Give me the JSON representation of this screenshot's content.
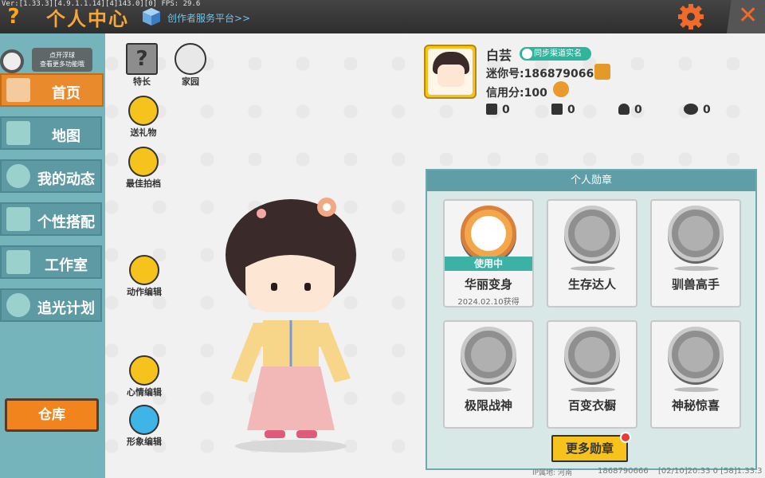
{
  "topbar": {
    "debug": "Ver:[1.33.3][4.9.1.1.14][4]143.0][0] FPS: 29.6",
    "help": "?",
    "title": "个人中心",
    "creator_link": "创作者服务平台>>",
    "close": "✕"
  },
  "float_tip": {
    "line1": "点开浮球",
    "line2": "查看更多功能哦"
  },
  "sidebar": {
    "items": [
      {
        "label": "首页",
        "active": true
      },
      {
        "label": "地图"
      },
      {
        "label": "我的动态"
      },
      {
        "label": "个性搭配"
      },
      {
        "label": "工作室"
      },
      {
        "label": "追光计划"
      }
    ],
    "warehouse": "仓库"
  },
  "side_buttons": {
    "specialty": "特长",
    "home": "家园",
    "gift": "送礼物",
    "best_photo": "最佳拍档",
    "action_edit": "动作编辑",
    "mood_edit": "心情编辑",
    "look_edit": "形象编辑"
  },
  "profile": {
    "name": "白芸",
    "realname_badge": "同步渠道实名",
    "mini_id": "迷你号:1868790666",
    "credit": "信用分:100",
    "stats": [
      "0",
      "0",
      "0",
      "0"
    ]
  },
  "medals": {
    "header": "个人勋章",
    "items": [
      {
        "name": "华丽变身",
        "date": "2024.02.10获得",
        "status": "使用中"
      },
      {
        "name": "生存达人"
      },
      {
        "name": "驯兽高手"
      },
      {
        "name": "极限战神"
      },
      {
        "name": "百变衣橱"
      },
      {
        "name": "神秘惊喜"
      }
    ],
    "more": "更多勋章"
  },
  "footer": {
    "ip": "IP属地: 河南",
    "id": "1868790666",
    "info": "[02/10]20:33 0  [58]1.33.3"
  },
  "colors": {
    "accent": "#f4a73a",
    "sidebar": "#76b4bc",
    "active": "#e98a2c",
    "teal": "#5f9ea6"
  }
}
